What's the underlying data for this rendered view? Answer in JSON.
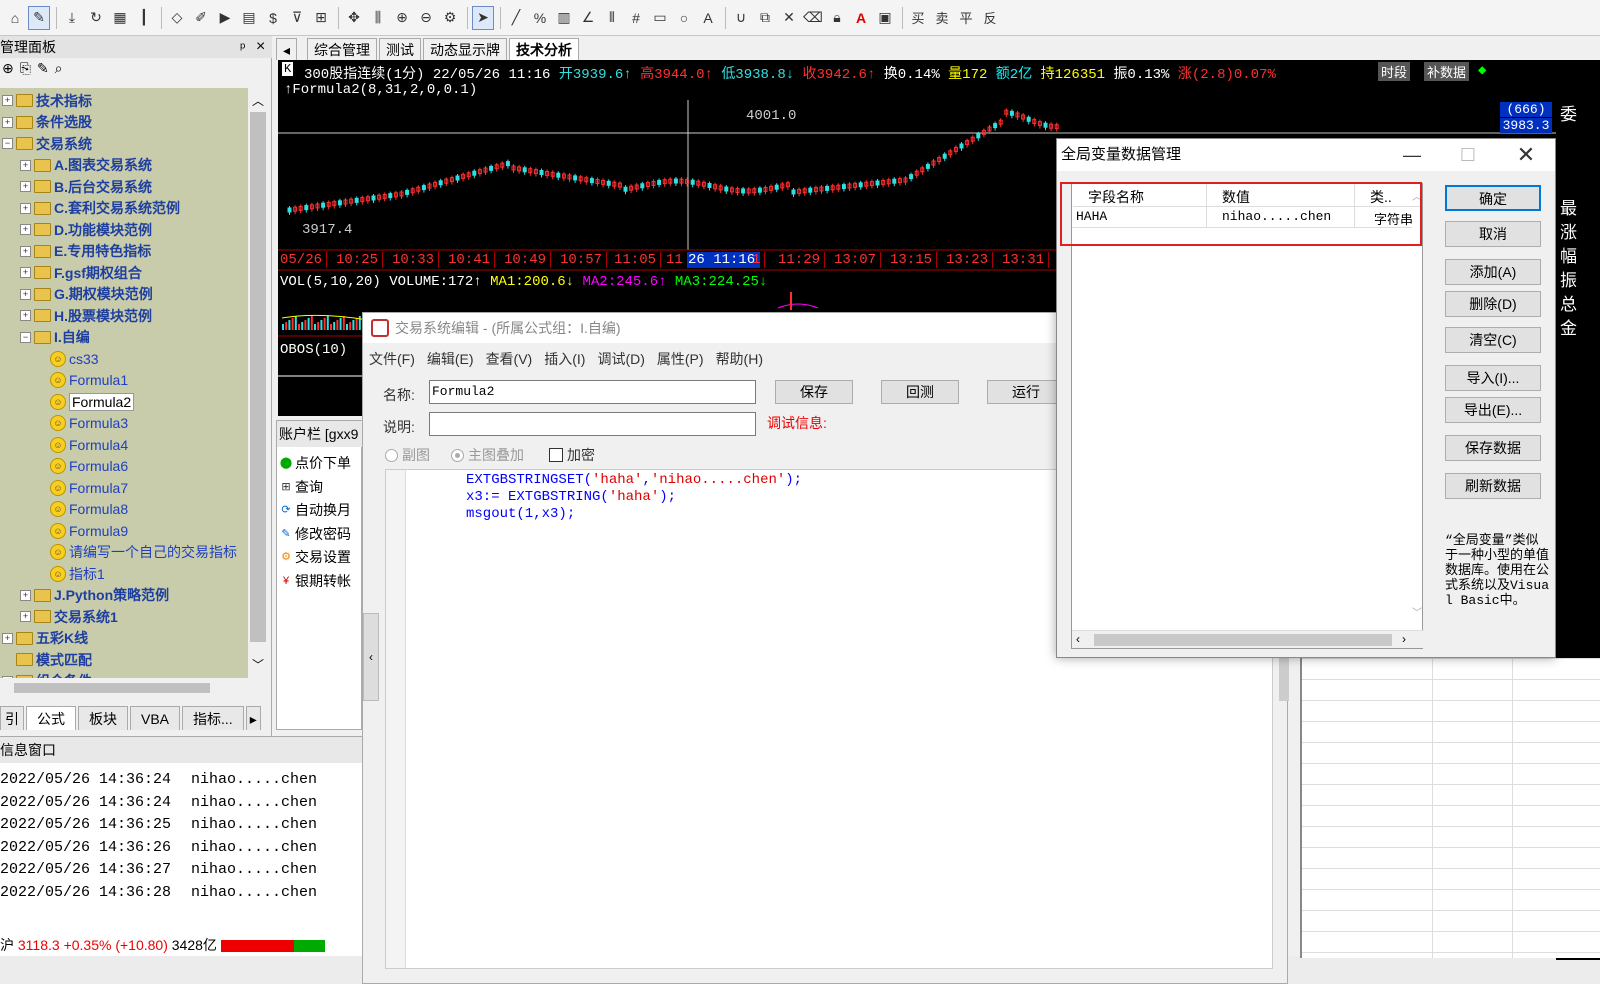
{
  "toolbar": {
    "icons": [
      "home-icon",
      "pen-icon",
      "download-icon",
      "refresh-icon",
      "grid-icon",
      "kline-icon",
      "diamond-icon",
      "edit-icon",
      "play-icon",
      "doc-icon",
      "dollar-icon",
      "filter-icon",
      "calc-icon",
      "move-icon",
      "ruler-icon",
      "zoom-in-icon",
      "zoom-out-icon",
      "gear-icon",
      "pointer-icon",
      "line-icon",
      "percent-icon",
      "bars-icon",
      "angle-icon",
      "parallel-icon",
      "hash-icon",
      "rect-icon",
      "circle-icon",
      "text-icon",
      "magnet-icon",
      "copy-icon",
      "erase-icon",
      "trash-icon",
      "lock-icon",
      "color-icon",
      "save-icon",
      "buy-icon",
      "sell-icon",
      "flat-icon",
      "reverse-icon"
    ],
    "labels": {
      "buy": "买",
      "sell": "卖",
      "flat": "平",
      "reverse": "反"
    }
  },
  "left_panel": {
    "title": "管理面板",
    "pin": "ᵖ",
    "close": "×",
    "tree": [
      {
        "label": "技术指标",
        "level": 0,
        "type": "folder",
        "expand": "+"
      },
      {
        "label": "条件选股",
        "level": 0,
        "type": "folder",
        "expand": "+"
      },
      {
        "label": "交易系统",
        "level": 0,
        "type": "folder",
        "expand": "−"
      },
      {
        "label": "A.图表交易系统",
        "level": 1,
        "type": "folder",
        "expand": "+"
      },
      {
        "label": "B.后台交易系统",
        "level": 1,
        "type": "folder",
        "expand": "+"
      },
      {
        "label": "C.套利交易系统范例",
        "level": 1,
        "type": "folder",
        "expand": "+"
      },
      {
        "label": "D.功能模块范例",
        "level": 1,
        "type": "folder",
        "expand": "+"
      },
      {
        "label": "E.专用特色指标",
        "level": 1,
        "type": "folder",
        "expand": "+"
      },
      {
        "label": "F.gsf期权组合",
        "level": 1,
        "type": "folder",
        "expand": "+"
      },
      {
        "label": "G.期权模块范例",
        "level": 1,
        "type": "folder",
        "expand": "+"
      },
      {
        "label": "H.股票模块范例",
        "level": 1,
        "type": "folder",
        "expand": "+"
      },
      {
        "label": "I.自编",
        "level": 1,
        "type": "folder",
        "expand": "−"
      },
      {
        "label": "cs33",
        "level": 2,
        "type": "formula"
      },
      {
        "label": "Formula1",
        "level": 2,
        "type": "formula"
      },
      {
        "label": "Formula2",
        "level": 2,
        "type": "formula",
        "selected": true
      },
      {
        "label": "Formula3",
        "level": 2,
        "type": "formula"
      },
      {
        "label": "Formula4",
        "level": 2,
        "type": "formula"
      },
      {
        "label": "Formula6",
        "level": 2,
        "type": "formula"
      },
      {
        "label": "Formula7",
        "level": 2,
        "type": "formula"
      },
      {
        "label": "Formula8",
        "level": 2,
        "type": "formula"
      },
      {
        "label": "Formula9",
        "level": 2,
        "type": "formula"
      },
      {
        "label": "请编写一个自己的交易指标",
        "level": 2,
        "type": "formula"
      },
      {
        "label": "指标1",
        "level": 2,
        "type": "formula"
      },
      {
        "label": "J.Python策略范例",
        "level": 1,
        "type": "folder",
        "expand": "+"
      },
      {
        "label": "交易系统1",
        "level": 1,
        "type": "folder",
        "expand": "+"
      },
      {
        "label": "五彩K线",
        "level": 0,
        "type": "folder",
        "expand": "+"
      },
      {
        "label": "模式匹配",
        "level": 0,
        "type": "folder",
        "expand": ""
      },
      {
        "label": "组合条件",
        "level": 0,
        "type": "folder",
        "expand": "+"
      }
    ],
    "tabs": [
      "引",
      "公式",
      "板块",
      "VBA",
      "指标..."
    ]
  },
  "info_window": {
    "title": "信息窗口",
    "logs": [
      {
        "time": "2022/05/26 14:36:24",
        "msg": "nihao.....chen"
      },
      {
        "time": "2022/05/26 14:36:24",
        "msg": "nihao.....chen"
      },
      {
        "time": "2022/05/26 14:36:25",
        "msg": "nihao.....chen"
      },
      {
        "time": "2022/05/26 14:36:26",
        "msg": "nihao.....chen"
      },
      {
        "time": "2022/05/26 14:36:27",
        "msg": "nihao.....chen"
      },
      {
        "time": "2022/05/26 14:36:28",
        "msg": "nihao.....chen"
      }
    ]
  },
  "status": {
    "market": "沪",
    "index": "3118.3",
    "change_pct": "+0.35%",
    "change": "(+10.80)",
    "amount": "3428亿"
  },
  "chart_tabs": [
    "综合管理",
    "测试",
    "动态显示牌",
    "技术分析"
  ],
  "chart": {
    "header": {
      "period_icon": "K",
      "symbol": "300股指连续(1分)",
      "date": "22/05/26",
      "time": "11:16",
      "open": "开3939.6↑",
      "high": "高3944.0↑",
      "low": "低3938.8↓",
      "close": "收3942.6↑",
      "turnover": "换0.14%",
      "volume": "量172",
      "amount": "额2亿",
      "hold": "持126351",
      "amplitude": "振0.13%",
      "rise": "涨(2.8)0.07%",
      "btn_period": "时段",
      "btn_fill": "补数据"
    },
    "formula_label": "↑Formula2(8,31,2,0,0.1)",
    "high_label": "4001.0",
    "low_label": "3917.4",
    "price_box_count": "(666)",
    "price_box_value": "3983.3",
    "time_axis": [
      "05/26",
      "10:25",
      "10:33",
      "10:41",
      "10:49",
      "10:57",
      "11:05",
      "11",
      "26 11:16",
      "1",
      "11:29",
      "13:07",
      "13:15",
      "13:23",
      "13:31"
    ],
    "vol_label": "VOL(5,10,20)",
    "vol_value": "VOLUME:172↑",
    "ma1": "MA1:200.6↓",
    "ma2": "MA2:245.6↑",
    "ma3": "MA3:224.25↓",
    "obos_label": "OBOS(10)",
    "colors": {
      "up": "#ff3030",
      "down": "#30e0e0",
      "bg": "#000000",
      "ma1": "#ffff00",
      "ma2": "#ff00ff",
      "ma3": "#00ff00"
    }
  },
  "account": {
    "title": "账户栏 [gxx9",
    "items": [
      {
        "label": "点价下单",
        "icon": "order-icon"
      },
      {
        "label": "查询",
        "icon": "query-icon"
      },
      {
        "label": "自动换月",
        "icon": "auto-icon"
      },
      {
        "label": "修改密码",
        "icon": "password-icon"
      },
      {
        "label": "交易设置",
        "icon": "settings-icon"
      },
      {
        "label": "银期转帐",
        "icon": "transfer-icon"
      }
    ]
  },
  "editor": {
    "title": "交易系统编辑 - (所属公式组：I.自编)",
    "menu": [
      "文件(F)",
      "编辑(E)",
      "查看(V)",
      "插入(I)",
      "调试(D)",
      "属性(P)",
      "帮助(H)"
    ],
    "name_label": "名称:",
    "name_value": "Formula2",
    "desc_label": "说明:",
    "desc_value": "",
    "btn_save": "保存",
    "btn_backtest": "回测",
    "btn_run": "运行",
    "debug_label": "调试信息:",
    "opt_sub": "副图",
    "opt_main": "主图叠加",
    "opt_encrypt": "加密",
    "code": [
      {
        "prefix": "EXTGBSTRINGSET(",
        "s1": "'haha'",
        "mid": ",",
        "s2": "'nihao.....chen'",
        "suffix": ");"
      },
      {
        "prefix": "x3:= EXTGBSTRING(",
        "s1": "'haha'",
        "mid": "",
        "s2": "",
        "suffix": ");"
      },
      {
        "prefix": "msgout(1,x3);",
        "s1": "",
        "mid": "",
        "s2": "",
        "suffix": ""
      }
    ]
  },
  "gvar_dialog": {
    "title": "全局变量数据管理",
    "columns": [
      "字段名称",
      "数值",
      "类.."
    ],
    "rows": [
      {
        "name": "HAHA",
        "value": "nihao.....chen",
        "type": "字符串"
      }
    ],
    "buttons": [
      "确定",
      "取消",
      "添加(A)",
      "删除(D)",
      "清空(C)",
      "导入(I)...",
      "导出(E)...",
      "保存数据",
      "刷新数据"
    ],
    "note": "“全局变量”类似于一种小型的单值数据库。使用在公式系统以及Visual Basic中。"
  },
  "right_strip": {
    "chars": [
      "委",
      "最",
      "涨",
      "幅",
      "振",
      "总",
      "金"
    ]
  }
}
